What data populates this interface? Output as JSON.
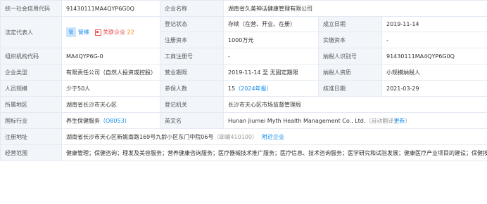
{
  "colors": {
    "link": "#128bed",
    "label_bg": "#f2f6fb",
    "border": "#e4eaf2",
    "red": "#e84a4a",
    "orange": "#f08400"
  },
  "row1": {
    "credit_code_label": "统一社会信用代码",
    "credit_code": "91430111MA4QYP6G0Q",
    "name_label": "企业名称",
    "name": "湖南省久美神话健康管理有限公司"
  },
  "row2": {
    "legal_label": "法定代表人",
    "legal_avatar": "管",
    "legal_name": "管维",
    "related_label": "关联企业",
    "related_count": "22",
    "reg_status_label": "登记状态",
    "reg_status": "存续（在营、开业、在册）",
    "est_date_label": "成立日期",
    "est_date": "2019-11-14"
  },
  "row3": {
    "capital_label": "注册资本",
    "capital": "1000万元",
    "paid_label": "实缴资本",
    "paid": "-"
  },
  "row4": {
    "org_code_label": "组织机构代码",
    "org_code": "MA4QYP6G-0",
    "biz_reg_label": "工商注册号",
    "biz_reg": "-",
    "tax_id_label": "纳税人识别号",
    "tax_id": "91430111MA4QYP6G0Q"
  },
  "row5": {
    "type_label": "企业类型",
    "type": "有限责任公司（自然人投资或控股）",
    "term_label": "营业期限",
    "term": "2019-11-14 至 无固定期限",
    "taxpayer_label": "纳税人资质",
    "taxpayer": "小规模纳税人"
  },
  "row6": {
    "staff_label": "人员规模",
    "staff": "少于50人",
    "insured_label": "参保人数",
    "insured_num": "15",
    "insured_year": "（2024年报）",
    "approve_label": "核准日期",
    "approve_date": "2021-03-29"
  },
  "row7": {
    "region_label": "所属地区",
    "region": "湖南省长沙市天心区",
    "authority_label": "登记机关",
    "authority": "长沙市天心区市场监督管理局"
  },
  "row8": {
    "industry_label": "国标行业",
    "industry": "养生保健服务",
    "industry_code": "（O8053）",
    "en_name_label": "英文名",
    "en_name": "Hunan Jiumei Myth Health Management Co., Ltd.",
    "en_note": "（自动翻译",
    "en_update": "更新",
    "en_close": "）"
  },
  "row9": {
    "address_label": "注册地址",
    "address": "湖南省长沙市天心区新姚南路169号九龄小区东门中院06号",
    "postcode": "（邮编410100）",
    "nearby": "附近企业"
  },
  "row10": {
    "scope_label": "经营范围",
    "scope": "健康管理；保健咨询；理发及美容服务；营养健康咨询服务；医疗器械技术推广服务；医疗信息、技术咨询服务；医学研究和试验发展；健康医疗产业项目的建设；保健按摩；保健用品销售；保健食品、化妆品及卫生用品、卫生消毒用品、预包装食品的零售；市场管理服务；企业总部管理；教育管理；企业管理咨询服务；学术交流活动的组织；文化活动的组织与策划；培训活动的组织。（依法须经批准的项目，经相关部门批准后方可开展经营活动）"
  }
}
